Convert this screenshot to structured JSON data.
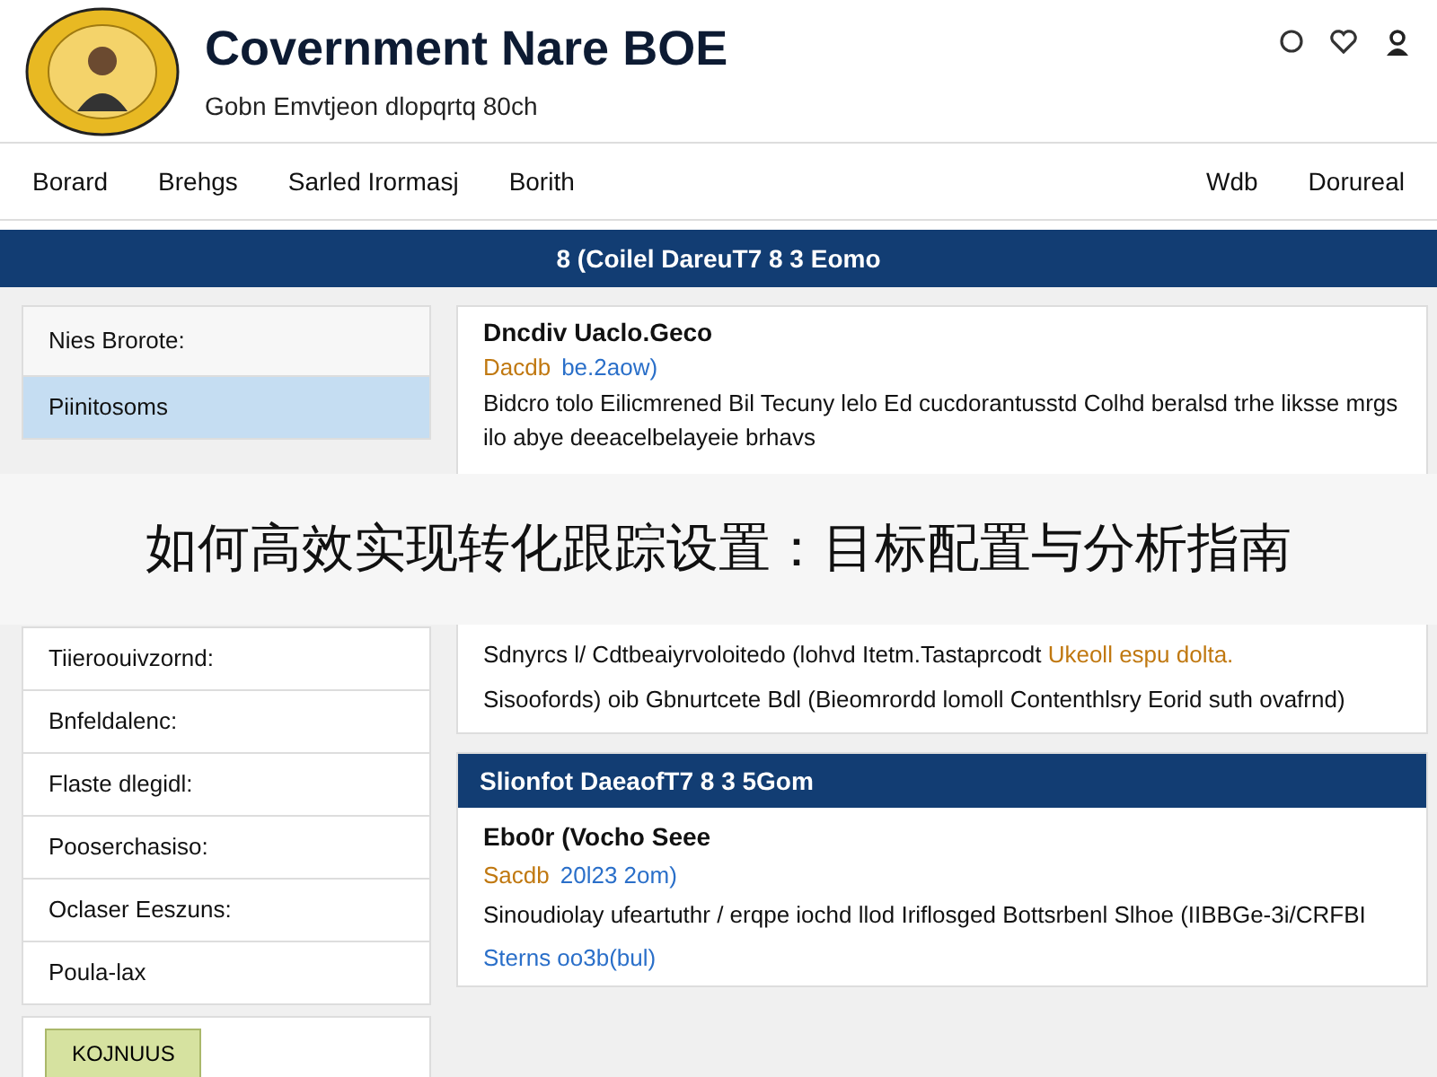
{
  "header": {
    "title": "Covernment Nare BOE",
    "subtitle": "Gobn Emvtjeon dlopqrtq 80ch"
  },
  "nav": {
    "left": [
      "Borard",
      "Brehgs",
      "Sarled Irormasj",
      "Borith"
    ],
    "right": [
      "Wdb",
      "Dorureal"
    ]
  },
  "banner": "8 (Coilel DareuT7 8 3 Eomo",
  "upper": {
    "sidebar": {
      "heading": "Nies Brorote:",
      "items": [
        {
          "label": "Piinitosoms",
          "selected": true
        }
      ]
    },
    "article": {
      "title": "Dncdiv Uaclo.Geco",
      "meta_date": "Dacdb",
      "meta_info": "be.2aow)",
      "paragraphs": [
        {
          "kind": "text",
          "text": "Bidcro tolo Eilicmrened Bil Tecuny lelo Ed cucdorantusstd Colhd beralsd trhe liksse mrgs ilo abye deeacelbelayeie brhavs"
        }
      ]
    }
  },
  "caption": "如何高效实现转化跟踪设置：目标配置与分析指南",
  "lower": {
    "sidebar": {
      "items": [
        {
          "label": "Tiieroouivzornd:",
          "selected": false
        },
        {
          "label": "Bnfeldalenc:",
          "selected": false
        },
        {
          "label": "Flaste dlegidl:",
          "selected": false
        },
        {
          "label": "Pooserchasiso:",
          "selected": false
        },
        {
          "label": "Oclaser Eeszuns:",
          "selected": false
        },
        {
          "label": "Poula-lax",
          "selected": false
        }
      ],
      "button": "KOJNUUS"
    },
    "article_end": {
      "paragraphs": [
        {
          "kind": "text",
          "text": "Sdnyrcs l/ Cdtbeaiyrvoloitedo (lohvd Itetm.Tastaprcodt",
          "accent": "Ukeoll espu dolta."
        },
        {
          "kind": "text",
          "text": "Sisoofords) oib Gbnurtcete Bdl (Bieomrordd lomoll Contenthlsry Eorid suth ovafrnd)"
        }
      ]
    },
    "section": {
      "header": "Slionfot DaeaofT7 8 3 5Gom",
      "title": "Ebo0r (Vocho Seee",
      "meta_date": "Sacdb",
      "meta_info": "20l23 2om)",
      "paragraphs": [
        {
          "kind": "text",
          "text": "Sinoudiolay ufeartuthr / erqpe iochd llod Iriflosged Bottsrbenl Slhoe (IIBBGe-3i/CRFBI"
        },
        {
          "kind": "link",
          "text": "Sterns oo3b(bul)"
        }
      ]
    }
  }
}
